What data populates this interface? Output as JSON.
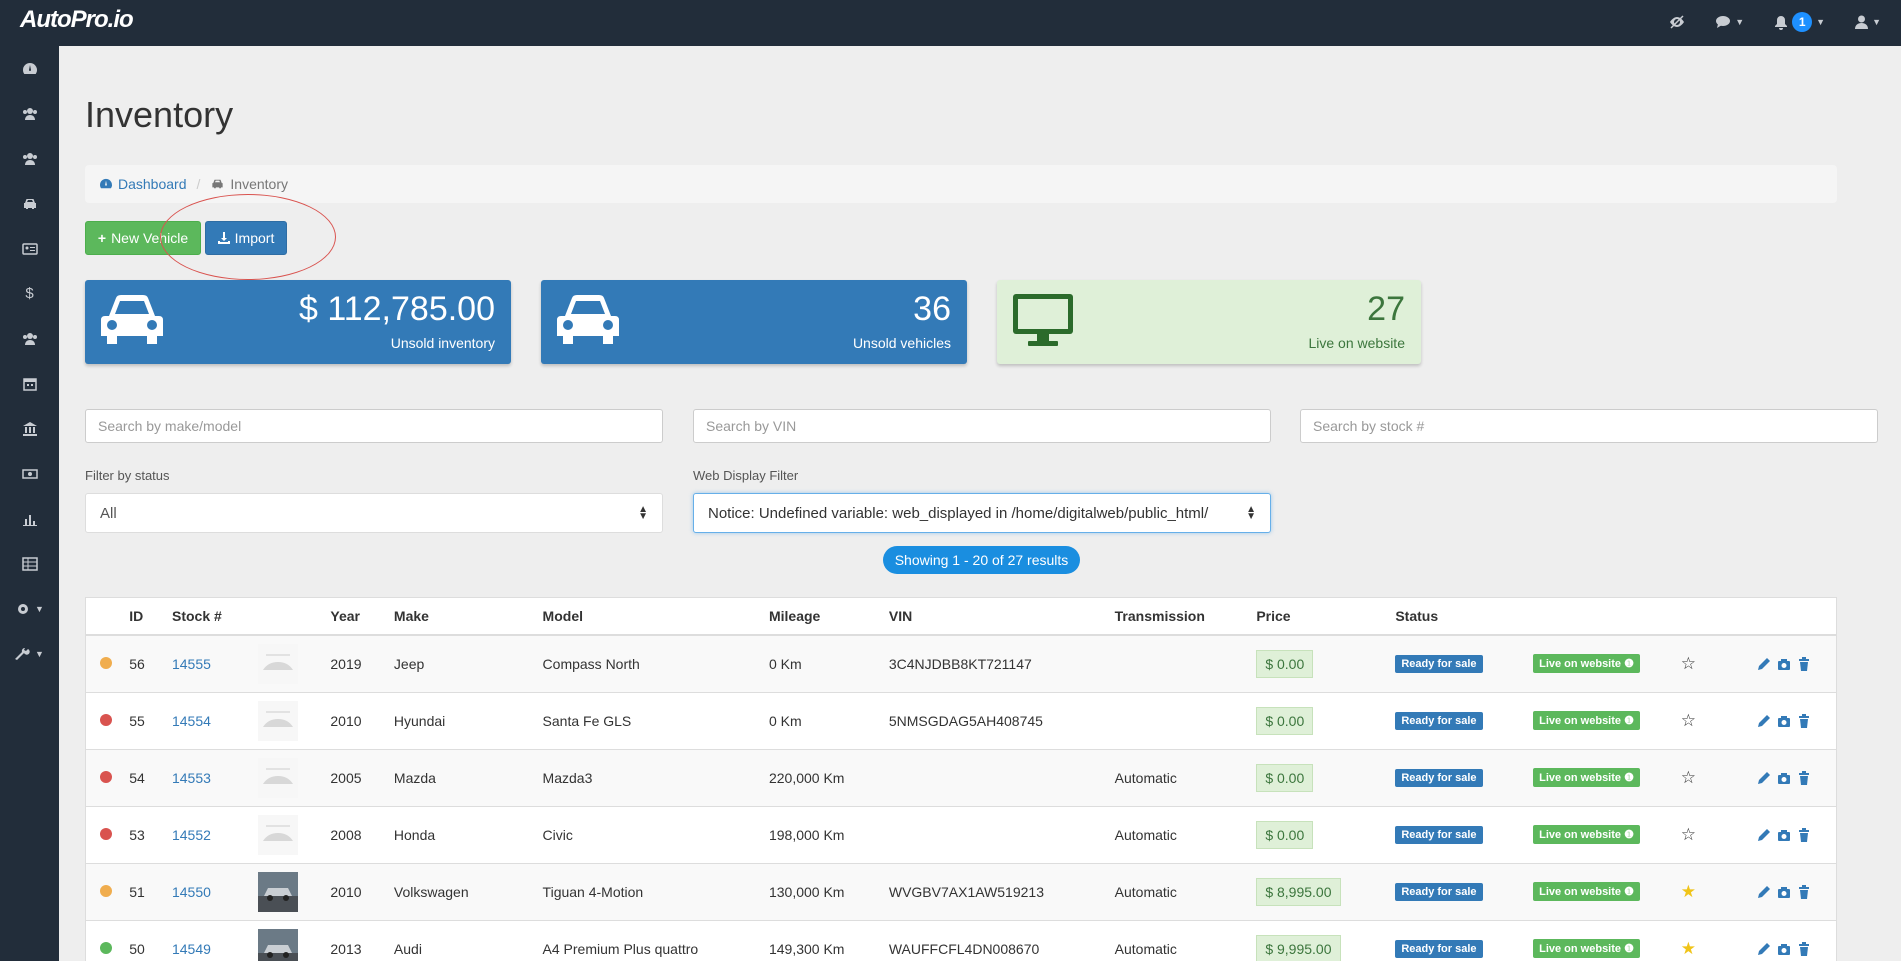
{
  "brand": "AutoPro.io",
  "topnav": {
    "notification_count": "1"
  },
  "page": {
    "title": "Inventory"
  },
  "breadcrumb": {
    "home": "Dashboard",
    "current": "Inventory"
  },
  "buttons": {
    "new_vehicle": "New Vehicle",
    "import": "Import"
  },
  "stats": [
    {
      "value": "$  112,785.00",
      "label": "Unsold inventory"
    },
    {
      "value": "36",
      "label": "Unsold vehicles"
    },
    {
      "value": "27",
      "label": "Live on website"
    }
  ],
  "search": {
    "make_model_placeholder": "Search by make/model",
    "vin_placeholder": "Search by VIN",
    "stock_placeholder": "Search by stock #"
  },
  "filters": {
    "status_label": "Filter by status",
    "status_value": "All",
    "web_label": "Web Display Filter",
    "web_value": "Notice: Undefined variable: web_displayed in /home/digitalweb/public_html/"
  },
  "results_text": "Showing 1 - 20 of 27 results",
  "table": {
    "headers": [
      "ID",
      "Stock #",
      "Year",
      "Make",
      "Model",
      "Mileage",
      "VIN",
      "Transmission",
      "Price",
      "Status"
    ],
    "rows": [
      {
        "dot": "#f0ad4e",
        "id": "56",
        "stock": "14555",
        "year": "2019",
        "make": "Jeep",
        "model": "Compass North",
        "mileage": "0 Km",
        "vin": "3C4NJDBB8KT721147",
        "transmission": "",
        "price": "$ 0.00",
        "status": "Ready for sale",
        "web": "Live on website",
        "featured": false,
        "photo": false
      },
      {
        "dot": "#d9534f",
        "id": "55",
        "stock": "14554",
        "year": "2010",
        "make": "Hyundai",
        "model": "Santa Fe GLS",
        "mileage": "0 Km",
        "vin": "5NMSGDAG5AH408745",
        "transmission": "",
        "price": "$ 0.00",
        "status": "Ready for sale",
        "web": "Live on website",
        "featured": false,
        "photo": false
      },
      {
        "dot": "#d9534f",
        "id": "54",
        "stock": "14553",
        "year": "2005",
        "make": "Mazda",
        "model": "Mazda3",
        "mileage": "220,000 Km",
        "vin": "",
        "transmission": "Automatic",
        "price": "$ 0.00",
        "status": "Ready for sale",
        "web": "Live on website",
        "featured": false,
        "photo": false
      },
      {
        "dot": "#d9534f",
        "id": "53",
        "stock": "14552",
        "year": "2008",
        "make": "Honda",
        "model": "Civic",
        "mileage": "198,000 Km",
        "vin": "",
        "transmission": "Automatic",
        "price": "$ 0.00",
        "status": "Ready for sale",
        "web": "Live on website",
        "featured": false,
        "photo": false
      },
      {
        "dot": "#f0ad4e",
        "id": "51",
        "stock": "14550",
        "year": "2010",
        "make": "Volkswagen",
        "model": "Tiguan 4-Motion",
        "mileage": "130,000 Km",
        "vin": "WVGBV7AX1AW519213",
        "transmission": "Automatic",
        "price": "$ 8,995.00",
        "status": "Ready for sale",
        "web": "Live on website",
        "featured": true,
        "photo": true
      },
      {
        "dot": "#5cb85c",
        "id": "50",
        "stock": "14549",
        "year": "2013",
        "make": "Audi",
        "model": "A4 Premium Plus quattro",
        "mileage": "149,300 Km",
        "vin": "WAUFFCFL4DN008670",
        "transmission": "Automatic",
        "price": "$ 9,995.00",
        "status": "Ready for sale",
        "web": "Live on website",
        "featured": true,
        "photo": true
      }
    ]
  }
}
